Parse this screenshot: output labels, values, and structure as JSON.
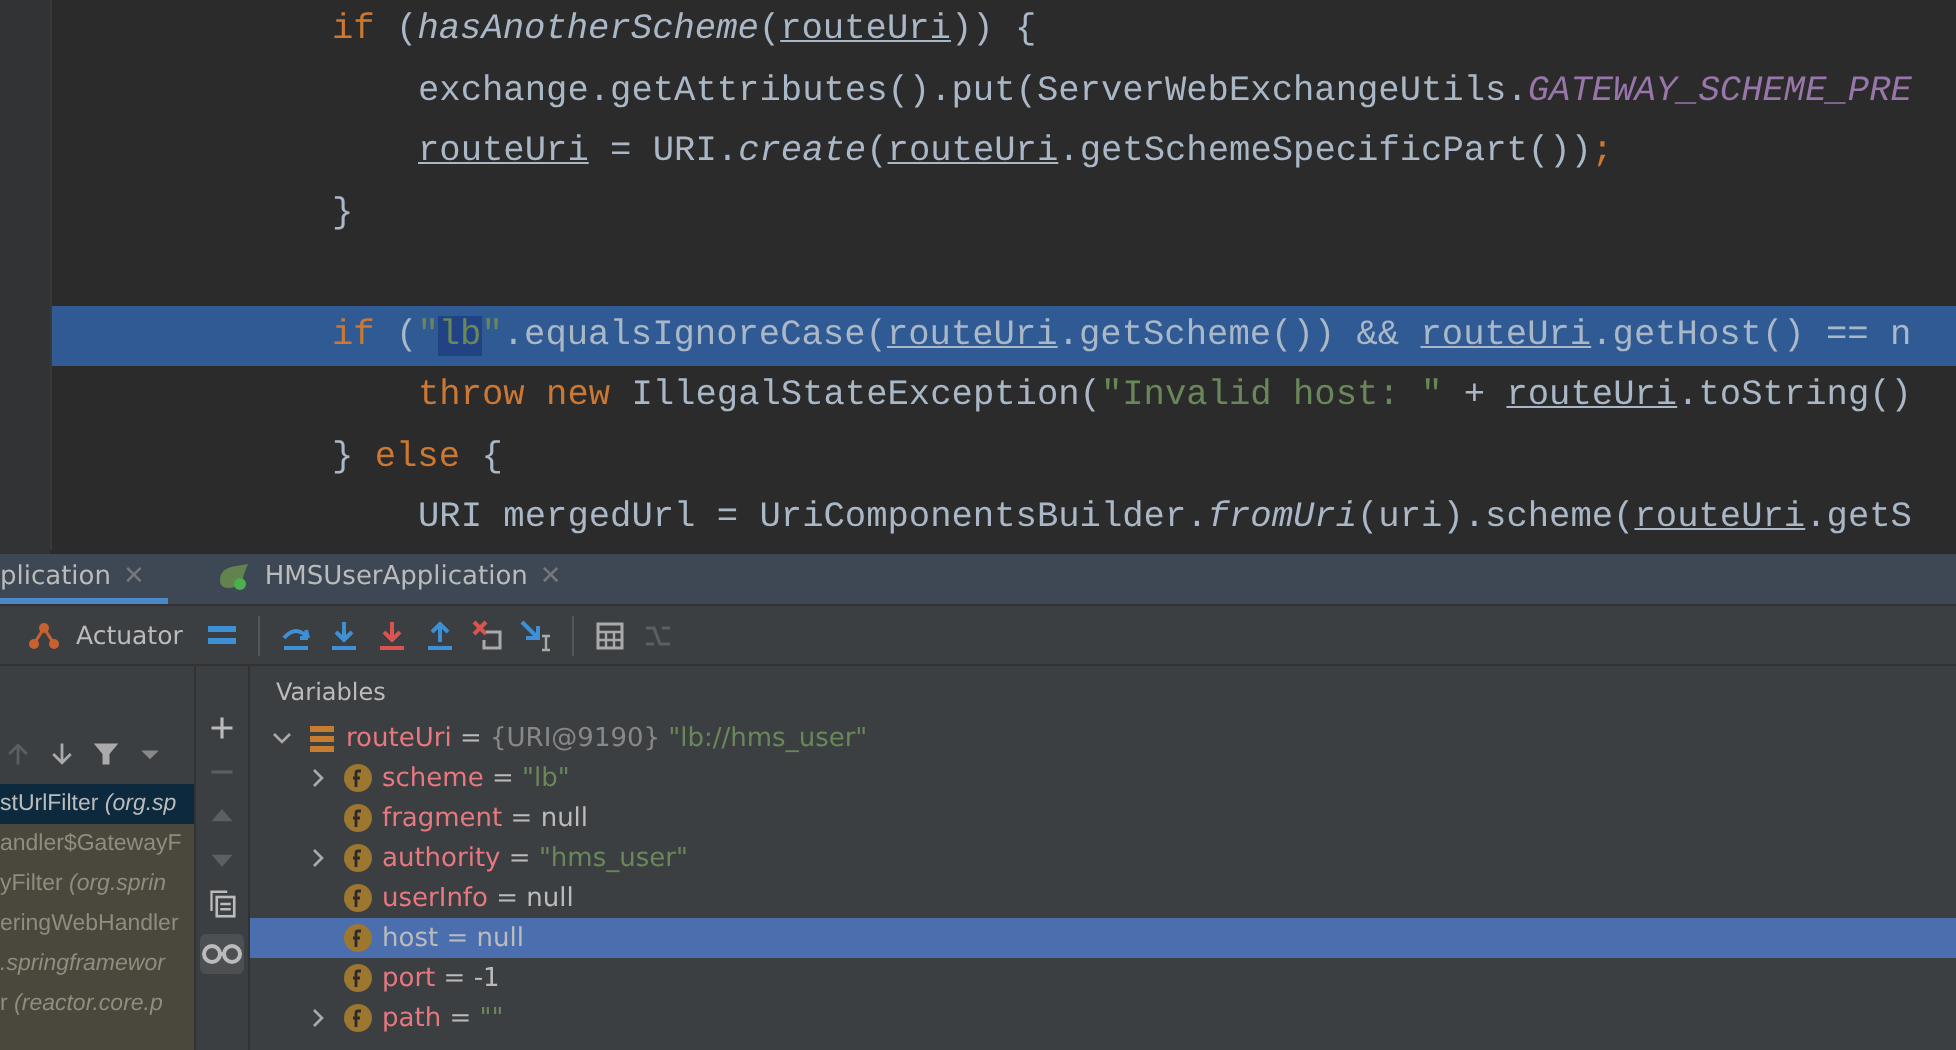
{
  "editor": {
    "lines": [
      {
        "highlighted": false,
        "tokens": [
          {
            "kind": "kw",
            "text": "if"
          },
          {
            "kind": "plain",
            "text": " ("
          },
          {
            "kind": "ital",
            "text": "hasAnotherScheme"
          },
          {
            "kind": "plain",
            "text": "("
          },
          {
            "kind": "var",
            "text": "routeUri"
          },
          {
            "kind": "plain",
            "text": ")) {"
          }
        ],
        "children": [
          {
            "highlighted": false,
            "tokens": [
              {
                "kind": "plain",
                "text": "exchange.getAttributes().put(ServerWebExchangeUtils."
              },
              {
                "kind": "const",
                "text": "GATEWAY_SCHEME_PRE"
              }
            ]
          },
          {
            "highlighted": false,
            "tokens": [
              {
                "kind": "var",
                "text": "routeUri"
              },
              {
                "kind": "plain",
                "text": " = URI."
              },
              {
                "kind": "ital",
                "text": "create"
              },
              {
                "kind": "plain",
                "text": "("
              },
              {
                "kind": "var",
                "text": "routeUri"
              },
              {
                "kind": "plain",
                "text": ".getSchemeSpecificPart())"
              },
              {
                "kind": "kw",
                "text": ";"
              }
            ]
          }
        ]
      },
      {
        "highlighted": false,
        "tokens": [
          {
            "kind": "plain",
            "text": "}"
          }
        ]
      },
      {
        "highlighted": false
      },
      {
        "highlighted": true,
        "tokens": [
          {
            "kind": "kw",
            "text": "if"
          },
          {
            "kind": "plain",
            "text": " ("
          },
          {
            "kind": "str",
            "text": "\""
          },
          {
            "kind": "match",
            "text": "lb"
          },
          {
            "kind": "str",
            "text": "\""
          },
          {
            "kind": "plain",
            "text": ".equalsIgnoreCase("
          },
          {
            "kind": "var",
            "text": "routeUri"
          },
          {
            "kind": "plain",
            "text": ".getScheme()) && "
          },
          {
            "kind": "var",
            "text": "routeUri"
          },
          {
            "kind": "plain",
            "text": ".getHost() == n"
          }
        ],
        "children": [
          {
            "highlighted": false,
            "tokens": [
              {
                "kind": "kw",
                "text": "throw new"
              },
              {
                "kind": "plain",
                "text": " IllegalStateException("
              },
              {
                "kind": "str",
                "text": "\"Invalid host: \""
              },
              {
                "kind": "plain",
                "text": " + "
              },
              {
                "kind": "var",
                "text": "routeUri"
              },
              {
                "kind": "plain",
                "text": ".toString()"
              }
            ]
          }
        ]
      },
      {
        "highlighted": false,
        "tokens": [
          {
            "kind": "plain",
            "text": "} "
          },
          {
            "kind": "kw",
            "text": "else"
          },
          {
            "kind": "plain",
            "text": " {"
          }
        ],
        "children": [
          {
            "highlighted": false,
            "tokens": [
              {
                "kind": "plain",
                "text": "URI mergedUrl = UriComponentsBuilder."
              },
              {
                "kind": "ital",
                "text": "fromUri"
              },
              {
                "kind": "plain",
                "text": "(uri).scheme("
              },
              {
                "kind": "var",
                "text": "routeUri"
              },
              {
                "kind": "plain",
                "text": ".getS"
              }
            ]
          }
        ]
      }
    ]
  },
  "debug_tabs": [
    {
      "label": "plication",
      "close": "✕",
      "selected": true,
      "icon": false
    },
    {
      "label": "HMSUserApplication",
      "close": "✕",
      "selected": false,
      "icon": true
    }
  ],
  "toolbar": {
    "actuator": "Actuator"
  },
  "frames": [
    {
      "text": "stUrlFilter *(org.sp*",
      "selected": true
    },
    {
      "text": "andler$GatewayF",
      "selected": false
    },
    {
      "text": "yFilter *(org.sprin*",
      "selected": false
    },
    {
      "text": "eringWebHandler",
      "selected": false
    },
    {
      "text": "*.springframewor*",
      "selected": false
    },
    {
      "text": "r *(reactor.core.p*",
      "selected": false
    }
  ],
  "variables": {
    "title": "Variables",
    "items": [
      {
        "kind": "object",
        "name": "routeUri",
        "operator": "=",
        "type": "{URI@9190}",
        "value": "\"lb://hms_user\"",
        "is_string": true,
        "expandable": true,
        "expanded": true,
        "selected": false,
        "children": [
          {
            "kind": "field",
            "name": "scheme",
            "operator": "=",
            "value": "\"lb\"",
            "is_string": true,
            "expandable": true,
            "expanded": false,
            "selected": false
          },
          {
            "kind": "field",
            "name": "fragment",
            "operator": "=",
            "value": "null",
            "is_string": false,
            "expandable": false,
            "expanded": false,
            "selected": false
          },
          {
            "kind": "field",
            "name": "authority",
            "operator": "=",
            "value": "\"hms_user\"",
            "is_string": true,
            "expandable": true,
            "expanded": false,
            "selected": false
          },
          {
            "kind": "field",
            "name": "userInfo",
            "operator": "=",
            "value": "null",
            "is_string": false,
            "expandable": false,
            "expanded": false,
            "selected": false
          },
          {
            "kind": "field",
            "name": "host",
            "operator": "=",
            "value": "null",
            "is_string": false,
            "expandable": false,
            "expanded": false,
            "selected": true
          },
          {
            "kind": "field",
            "name": "port",
            "operator": "=",
            "value": "-1",
            "is_string": false,
            "expandable": false,
            "expanded": false,
            "selected": false
          },
          {
            "kind": "field",
            "name": "path",
            "operator": "=",
            "value": "\"\"",
            "is_string": true,
            "expandable": true,
            "expanded": false,
            "selected": false
          }
        ]
      }
    ]
  }
}
